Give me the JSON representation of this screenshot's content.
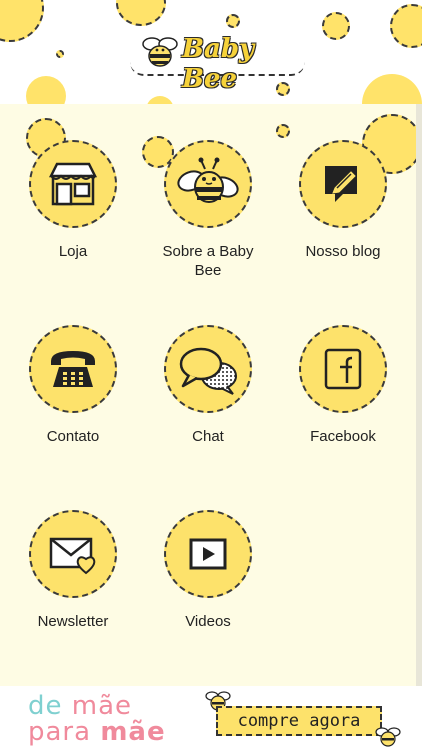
{
  "header": {
    "logo_text": "Baby Bee"
  },
  "menu": {
    "items": [
      {
        "label_line1": "Loja",
        "label_line2": "",
        "icon": "store-icon"
      },
      {
        "label_line1": "Sobre a Baby",
        "label_line2": "Bee",
        "icon": "bee-icon"
      },
      {
        "label_line1": "Nosso blog",
        "label_line2": "",
        "icon": "blog-edit-icon"
      },
      {
        "label_line1": "Contato",
        "label_line2": "",
        "icon": "telephone-icon"
      },
      {
        "label_line1": "Chat",
        "label_line2": "",
        "icon": "chat-bubbles-icon"
      },
      {
        "label_line1": "Facebook",
        "label_line2": "",
        "icon": "facebook-icon"
      },
      {
        "label_line1": "Newsletter",
        "label_line2": "",
        "icon": "envelope-heart-icon"
      },
      {
        "label_line1": "Videos",
        "label_line2": "",
        "icon": "video-play-icon"
      }
    ]
  },
  "footer": {
    "brand_top_1": "de ",
    "brand_top_2": "mãe",
    "brand_bottom_1": "para ",
    "brand_bottom_2": "mãe",
    "cta_label": "compre agora"
  },
  "colors": {
    "accent_yellow": "#fde26b",
    "panel_bg": "#fefce4",
    "brand_teal": "#7fd0d0",
    "brand_pink": "#f08a9c"
  }
}
